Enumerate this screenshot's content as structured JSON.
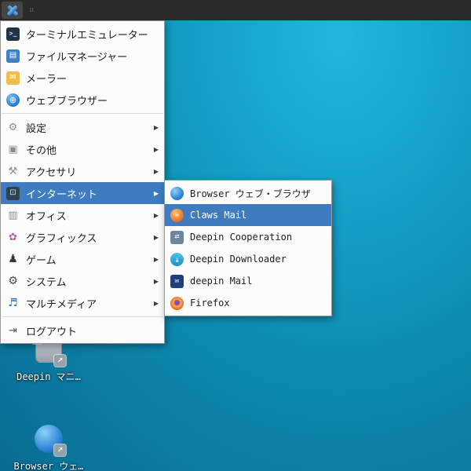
{
  "colors": {
    "highlight": "#3e7cbf",
    "panel_bg": "#2a2a2a",
    "menu_bg": "#fcfcfc",
    "desktop_teal_bright": "#23b5da",
    "desktop_teal_dark": "#086c92"
  },
  "panel": {
    "grip_glyph": "⠶"
  },
  "icons": {
    "terminal_glyph": ">_",
    "file_manager_glyph": "▤",
    "mail_glyph": "✉",
    "web_browser_glyph": "⊕",
    "settings_glyph": "⚙",
    "other_glyph": "▣",
    "accessories_glyph": "⚒",
    "internet_glyph": "⊡",
    "office_glyph": "▥",
    "graphics_glyph": "✿",
    "games_glyph": "♟",
    "system_glyph": "⚙",
    "multimedia_glyph": "♬",
    "logout_glyph": "⇥",
    "submenu_arrow_glyph": "▶",
    "claws_mail_glyph": "✉",
    "cooperation_glyph": "⇄",
    "downloader_glyph": "↓",
    "deepin_mail_glyph": "✉",
    "link_emblem_glyph": "↗"
  },
  "menu": {
    "items": [
      {
        "label": "ターミナルエミュレーター"
      },
      {
        "label": "ファイルマネージャー"
      },
      {
        "label": "メーラー"
      },
      {
        "label": "ウェブブラウザー"
      },
      {
        "label": "設定"
      },
      {
        "label": "その他"
      },
      {
        "label": "アクセサリ"
      },
      {
        "label": "インターネット",
        "selected": true
      },
      {
        "label": "オフィス"
      },
      {
        "label": "グラフィックス"
      },
      {
        "label": "ゲーム"
      },
      {
        "label": "システム"
      },
      {
        "label": "マルチメディア"
      },
      {
        "label": "ログアウト"
      }
    ]
  },
  "submenu": {
    "items": [
      {
        "label": "Browser ウェブ・ブラウザ"
      },
      {
        "label": "Claws Mail",
        "selected": true
      },
      {
        "label": "Deepin Cooperation"
      },
      {
        "label": "Deepin Downloader"
      },
      {
        "label": "deepin Mail"
      },
      {
        "label": "Firefox"
      }
    ]
  },
  "desktop": {
    "icons": [
      {
        "label": "Deepin マニ…"
      },
      {
        "label": "Browser ウェ…"
      }
    ]
  }
}
